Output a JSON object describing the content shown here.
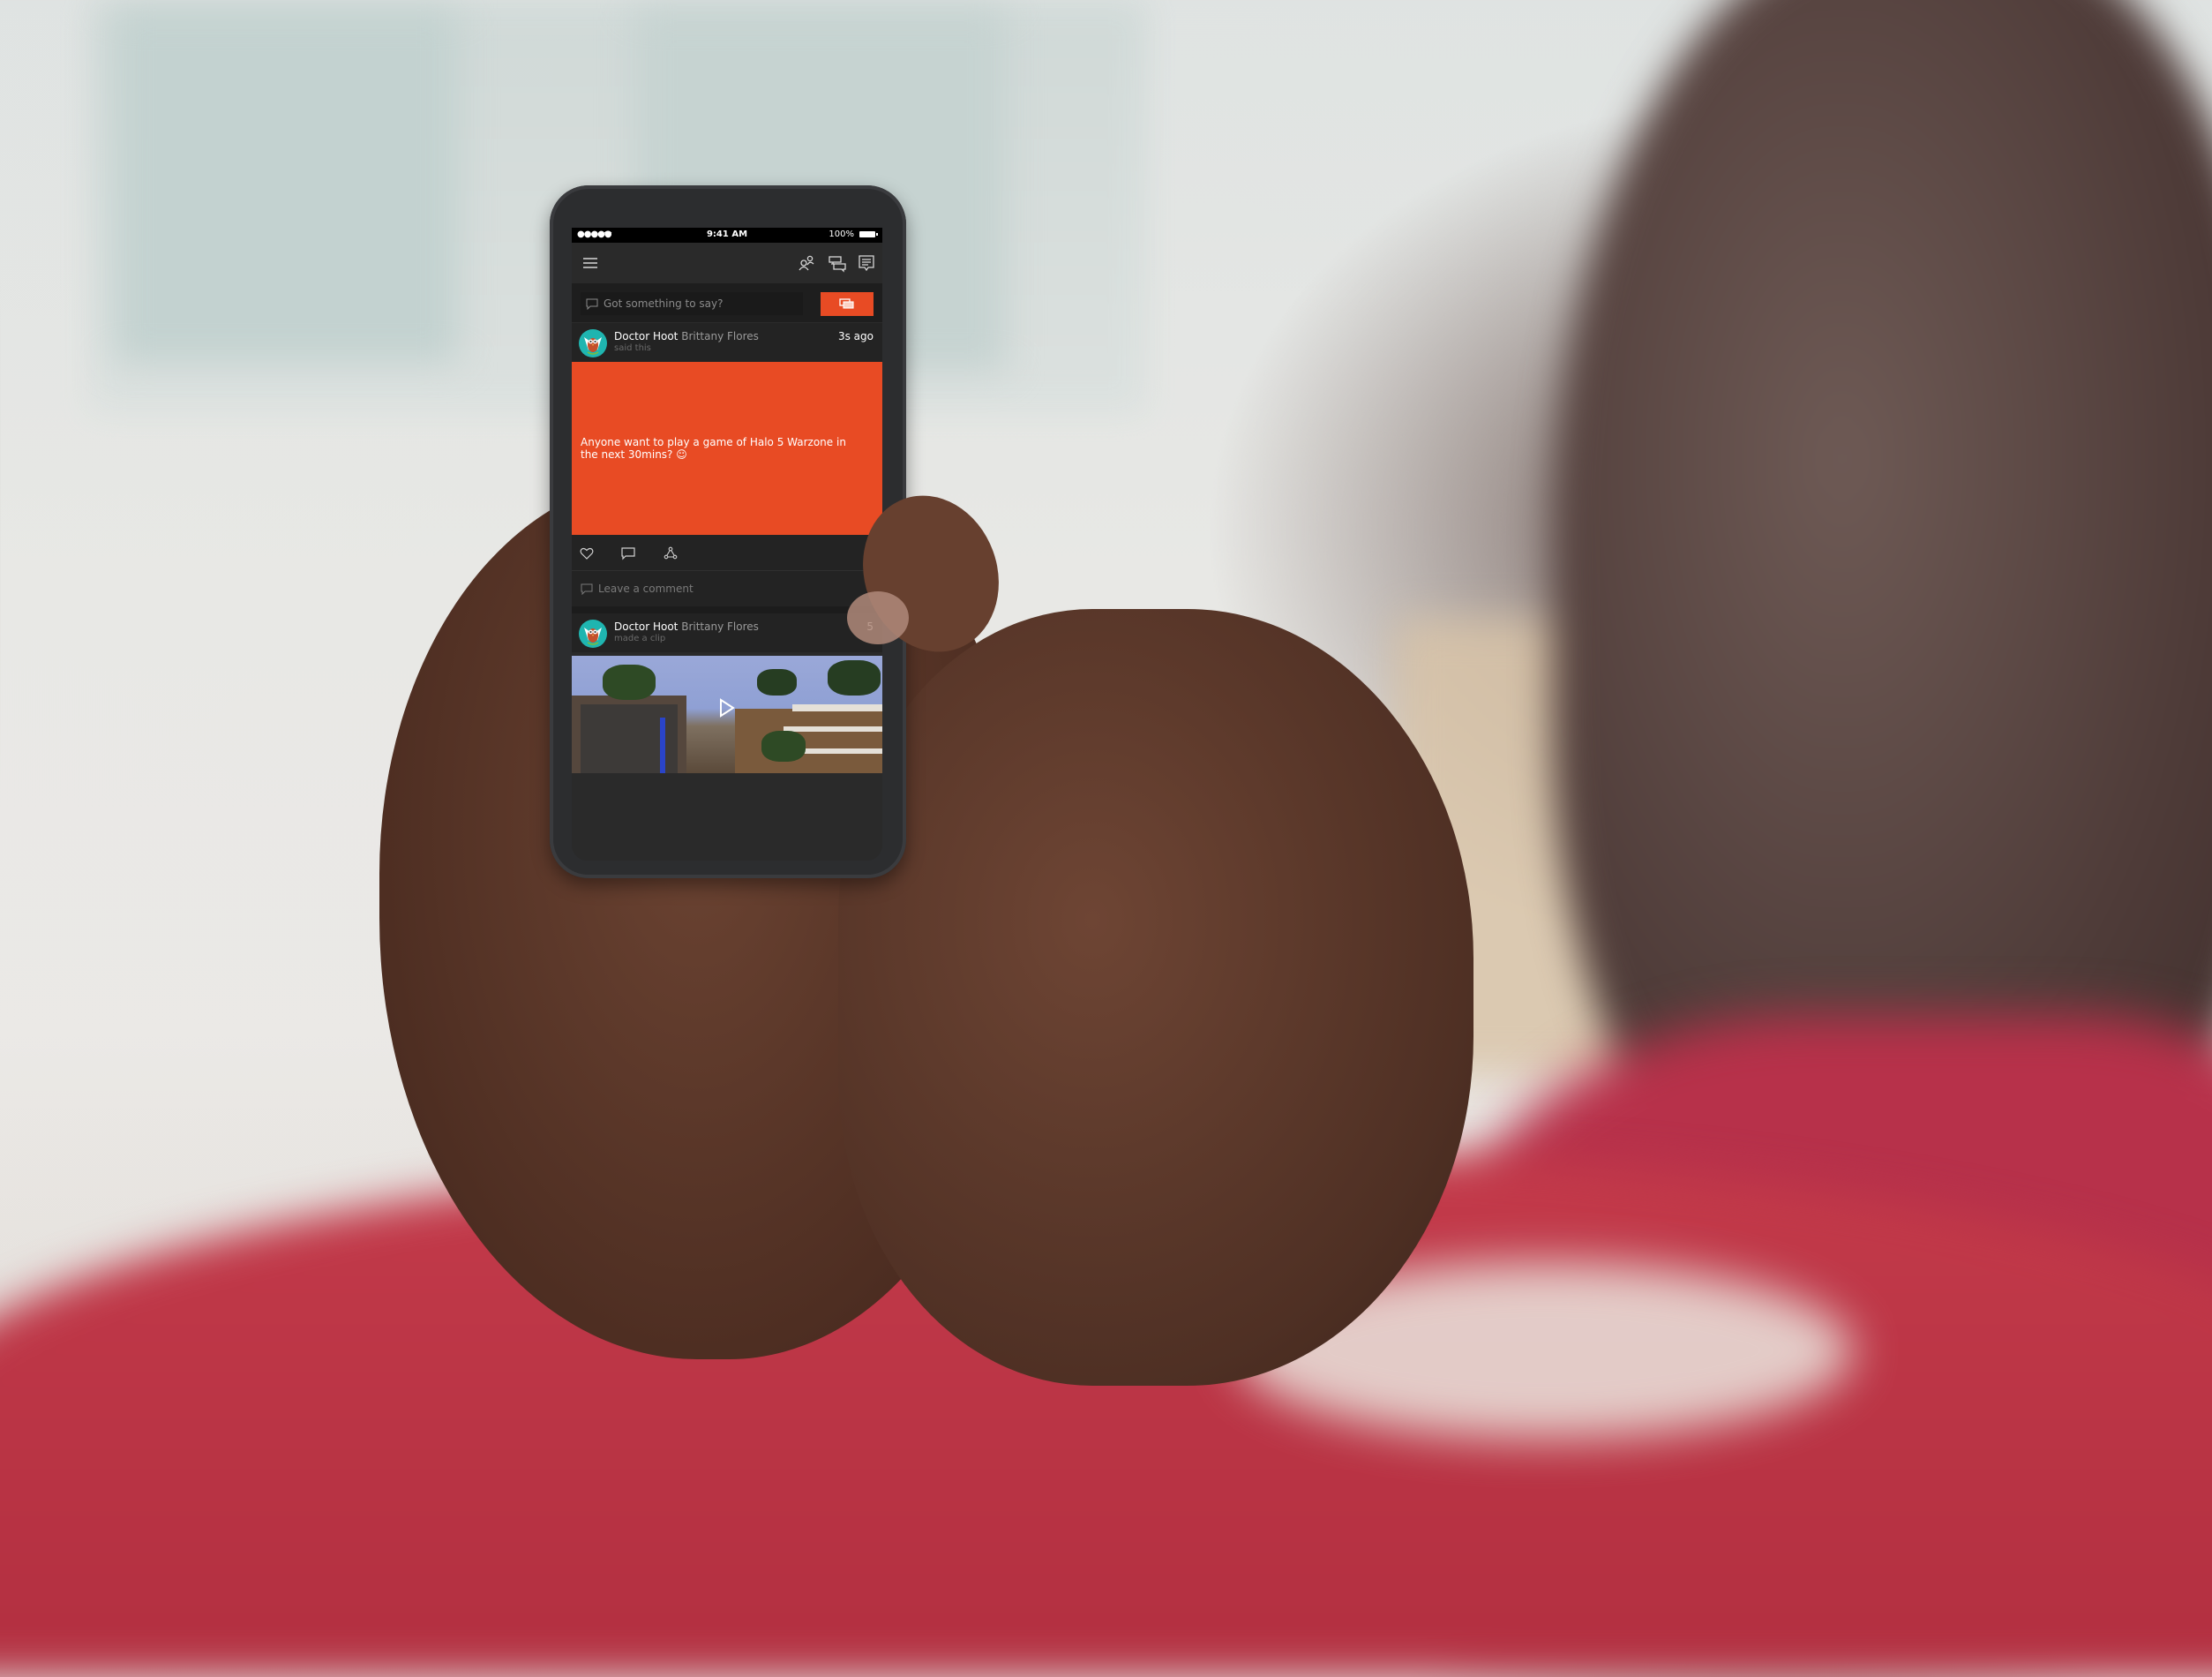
{
  "status_bar": {
    "signal": "●●●●●",
    "wifi_icon": "wifi-icon",
    "time": "9:41 AM",
    "battery": "100%",
    "battery_level": 1.0
  },
  "app_bar": {
    "icons": [
      "menu-icon",
      "friends-icon",
      "messages-icon",
      "notifications-icon"
    ]
  },
  "compose": {
    "placeholder": "Got something to say?",
    "post_button_icon": "post-icon"
  },
  "feed": [
    {
      "gamertag": "Doctor Hoot",
      "real_name": "Brittany Flores",
      "action": "said this",
      "time": "3s ago",
      "message": "Anyone want to play a game of Halo 5 Warzone in the next 30mins? ☺",
      "card_color": "#e84b24",
      "actions": [
        "like-icon",
        "comment-icon",
        "share-icon"
      ],
      "comment_placeholder": "Leave a comment"
    },
    {
      "gamertag": "Doctor Hoot",
      "real_name": "Brittany Flores",
      "action": "made a clip",
      "time": "5",
      "media": "video-clip-thumbnail"
    }
  ],
  "colors": {
    "accent": "#e84b24",
    "background": "#2a2a2a",
    "avatar_bg": "#1fb5b0"
  }
}
